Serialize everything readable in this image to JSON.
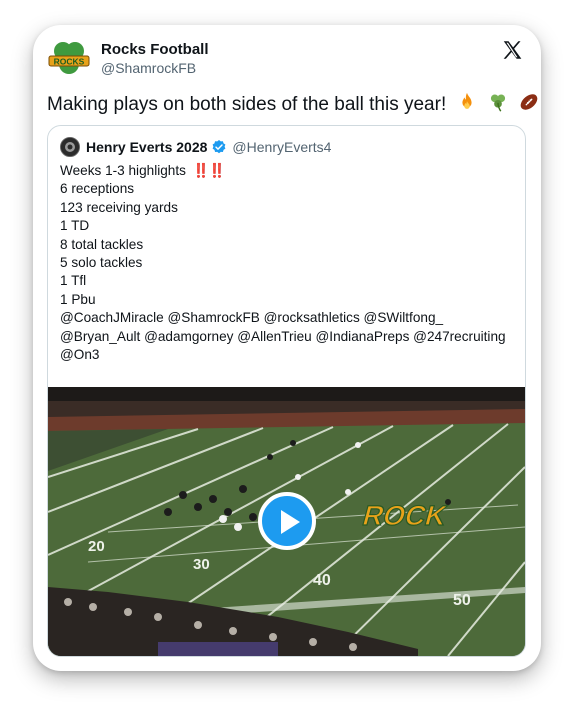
{
  "account": {
    "name": "Rocks Football",
    "handle": "@ShamrockFB",
    "logo_text": "ROCKS",
    "logo_color": "#2e7d32"
  },
  "post": {
    "text": "Making plays on both sides of the ball this year!",
    "emojis": [
      "fire",
      "shamrock",
      "football"
    ]
  },
  "quoted": {
    "name": "Henry Everts 2028",
    "handle": "@HenryEverts4",
    "verified": true,
    "lines": [
      "Weeks 1-3 highlights",
      "6 receptions",
      "123 receiving yards",
      "1 TD",
      "8 total tackles",
      "5 solo tackles",
      "1 Tfl",
      "1 Pbu",
      "@CoachJMiracle @ShamrockFB @rocksathletics @SWiltfong_",
      "@Bryan_Ault @adamgorney @AllenTrieu @IndianaPreps @247recruiting",
      "@On3"
    ],
    "highlight_marks": "‼️‼️"
  },
  "video": {
    "field_numbers": [
      "20",
      "30",
      "40",
      "50"
    ],
    "end_zone_text": "ROCK",
    "accent": "#1d9bf0"
  }
}
